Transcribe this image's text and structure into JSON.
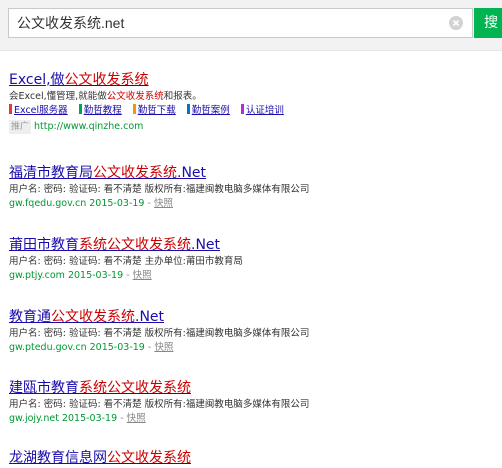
{
  "search": {
    "query": "公文收发系统.net",
    "button_label": "搜"
  },
  "ad": {
    "title_pre": "Excel,做",
    "title_hl": "公文收发系统",
    "desc_pre": "会Excel,懂管理,就能做",
    "desc_hl": "公文收发系统",
    "desc_post": "和报表。",
    "sitelinks": [
      {
        "label": "Excel服务器",
        "color": "#e4393c"
      },
      {
        "label": "勤哲教程",
        "color": "#00a651"
      },
      {
        "label": "勤哲下载",
        "color": "#f39800"
      },
      {
        "label": "勤哲案例",
        "color": "#0075c2"
      },
      {
        "label": "认证培训",
        "color": "#b12fd4"
      }
    ],
    "badge": "推广",
    "url": "http://www.qinzhe.com"
  },
  "results": [
    {
      "title_pre": "福清市教育局",
      "title_hl": "公文收发系统",
      "title_post": ".Net",
      "desc": "用户名: 密码: 验证码: 看不清楚 版权所有:福建闽教电脑多媒体有限公司",
      "url": "gw.fqedu.gov.cn 2015-03-19",
      "separator": "-",
      "snapshot": "快照"
    },
    {
      "title_pre": "莆田市教育",
      "title_hl": "系统公文收发系统",
      "title_post": ".Net",
      "desc": "用户名: 密码: 验证码: 看不清楚 主办单位:莆田市教育局",
      "url": "gw.ptjy.com 2015-03-19",
      "separator": "-",
      "snapshot": "快照"
    },
    {
      "title_pre": "教育通",
      "title_hl": "公文收发系统",
      "title_post": ".Net",
      "desc": "用户名: 密码: 验证码: 看不清楚 版权所有:福建闽教电脑多媒体有限公司",
      "url": "gw.ptedu.gov.cn 2015-03-19",
      "separator": "-",
      "snapshot": "快照"
    },
    {
      "title_pre": "建瓯市教育",
      "title_hl": "系统公文收发系统",
      "title_post": "",
      "desc": "用户名: 密码: 验证码: 看不清楚 版权所有:福建闽教电脑多媒体有限公司",
      "url": "gw.jojy.net 2015-03-19",
      "separator": "-",
      "snapshot": "快照"
    },
    {
      "title_pre": "龙湖教育信息网",
      "title_hl": "公文收发系统",
      "title_post": ""
    }
  ]
}
